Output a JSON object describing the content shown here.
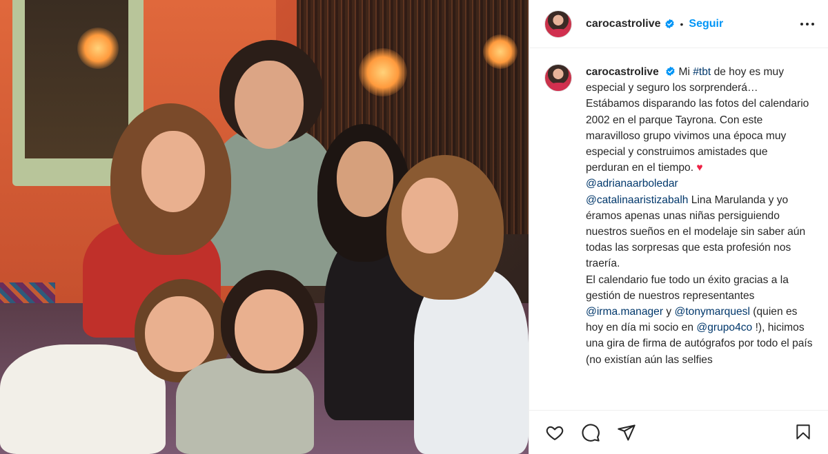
{
  "photo": {
    "alt_role": "post-photo"
  },
  "header": {
    "username": "carocastrolive",
    "separator": "•",
    "follow_label": "Seguir"
  },
  "caption": {
    "username": "carocastrolive",
    "text_1": "Mi ",
    "hashtag": "#tbt",
    "text_2": " de hoy es muy especial y seguro los sorprenderá… Estábamos disparando las fotos del calendario 2002 en el parque Tayrona. Con este maravilloso grupo vivimos una época muy especial y construimos amistades que perduran en el tiempo. ",
    "heart": "♥",
    "mention_1": "@adrianaarboledar",
    "mention_2": "@catalinaaristizabalh",
    "text_3": " Lina Marulanda y yo éramos apenas unas niñas persiguiendo nuestros sueños en el modelaje sin saber aún todas las sorpresas que esta profesión nos traería.",
    "text_4": "El calendario fue todo un éxito gracias a la gestión de nuestros representantes ",
    "mention_3": "@irma.manager",
    "text_5": " y ",
    "mention_4": "@tonymarquesl",
    "text_6": " (quien es hoy en día mi socio en ",
    "mention_5": "@grupo4co",
    "text_7": " !), hicimos una gira de firma de autógrafos por todo el país (no existían aún las selfies"
  },
  "icons": {
    "verified": "verified-badge-icon",
    "more": "more-options-icon",
    "like": "heart-icon",
    "comment": "comment-icon",
    "share": "share-icon",
    "save": "bookmark-icon"
  },
  "colors": {
    "accent": "#0095f6",
    "mention": "#00376b",
    "heart": "#ed2144",
    "text": "#262626"
  }
}
